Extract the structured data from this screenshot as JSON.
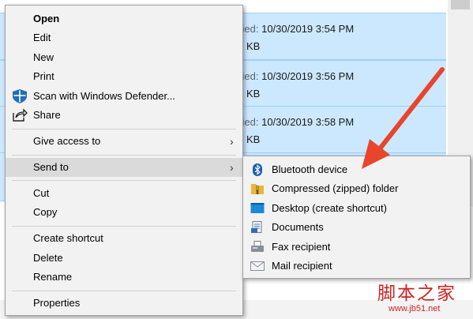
{
  "file_list": {
    "rows": [
      {
        "modified_label": "ified:",
        "modified": "10/30/2019 3:54 PM",
        "size": "KB"
      },
      {
        "modified_label": "ified:",
        "modified": "10/30/2019 3:56 PM",
        "size": "KB"
      },
      {
        "modified_label": "ified:",
        "modified": "10/30/2019 3:58 PM",
        "size": "KB"
      }
    ]
  },
  "context_menu": {
    "open": "Open",
    "edit": "Edit",
    "new": "New",
    "print": "Print",
    "scan": "Scan with Windows Defender...",
    "share": "Share",
    "give_access": "Give access to",
    "send_to": "Send to",
    "cut": "Cut",
    "copy": "Copy",
    "create_shortcut": "Create shortcut",
    "delete": "Delete",
    "rename": "Rename",
    "properties": "Properties"
  },
  "send_to_menu": {
    "bluetooth": "Bluetooth device",
    "compressed": "Compressed (zipped) folder",
    "desktop": "Desktop (create shortcut)",
    "documents": "Documents",
    "fax": "Fax recipient",
    "mail": "Mail recipient"
  },
  "icons": {
    "defender": "shield-icon",
    "share": "share-icon",
    "bluetooth": "bluetooth-icon",
    "zip": "zip-folder-icon",
    "desktop": "desktop-icon",
    "documents": "documents-icon",
    "fax": "fax-icon",
    "mail": "mail-icon"
  },
  "watermark": {
    "main": "脚本之家",
    "sub": "www.jb51.net"
  },
  "colors": {
    "selection": "#cce8ff",
    "menu_bg": "#f2f2f2",
    "highlight": "#dadada",
    "arrow": "#e8452c"
  }
}
